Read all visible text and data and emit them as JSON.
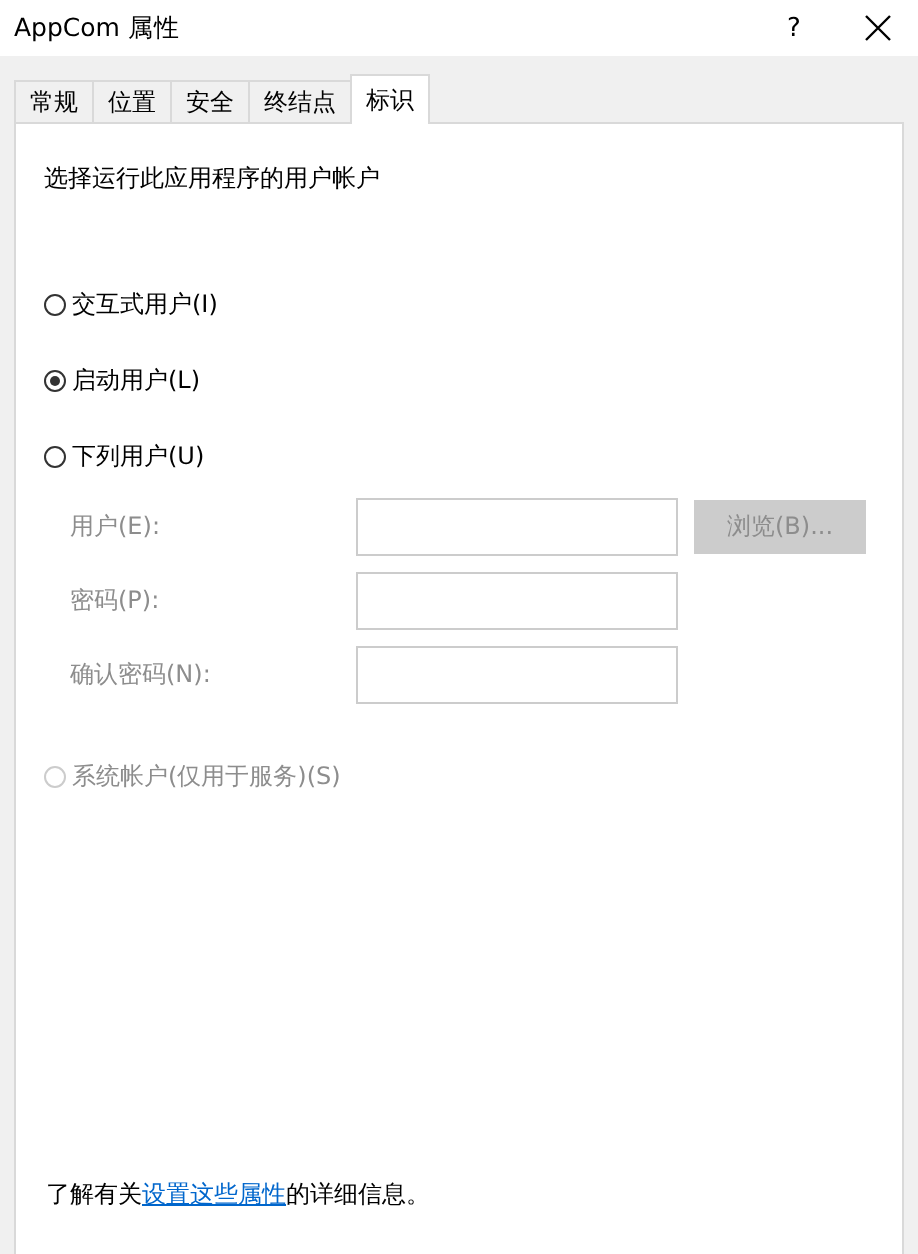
{
  "window": {
    "title": "AppCom 属性",
    "help": "?"
  },
  "tabs": [
    {
      "label": "常规",
      "selected": false
    },
    {
      "label": "位置",
      "selected": false
    },
    {
      "label": "安全",
      "selected": false
    },
    {
      "label": "终结点",
      "selected": false
    },
    {
      "label": "标识",
      "selected": true
    }
  ],
  "prompt": "选择运行此应用程序的用户帐户",
  "accounts": [
    {
      "label": "交互式用户(I)",
      "selected": false,
      "disabled": false
    },
    {
      "label": "启动用户(L)",
      "selected": true,
      "disabled": false
    },
    {
      "label": "下列用户(U)",
      "selected": false,
      "disabled": false
    }
  ],
  "user_fields": {
    "disabled": true,
    "fields": [
      {
        "label": "用户(E):"
      },
      {
        "label": "密码(P):"
      },
      {
        "label": "确认密码(N):"
      }
    ],
    "browse_button": {
      "label": "浏览(B)...",
      "disabled": true
    }
  },
  "system_account": {
    "label": "系统帐户(仅用于服务)(S)",
    "selected": false,
    "disabled": true
  },
  "footer": {
    "before": "了解有关",
    "link": "设置这些属性",
    "after": "的详细信息。"
  }
}
